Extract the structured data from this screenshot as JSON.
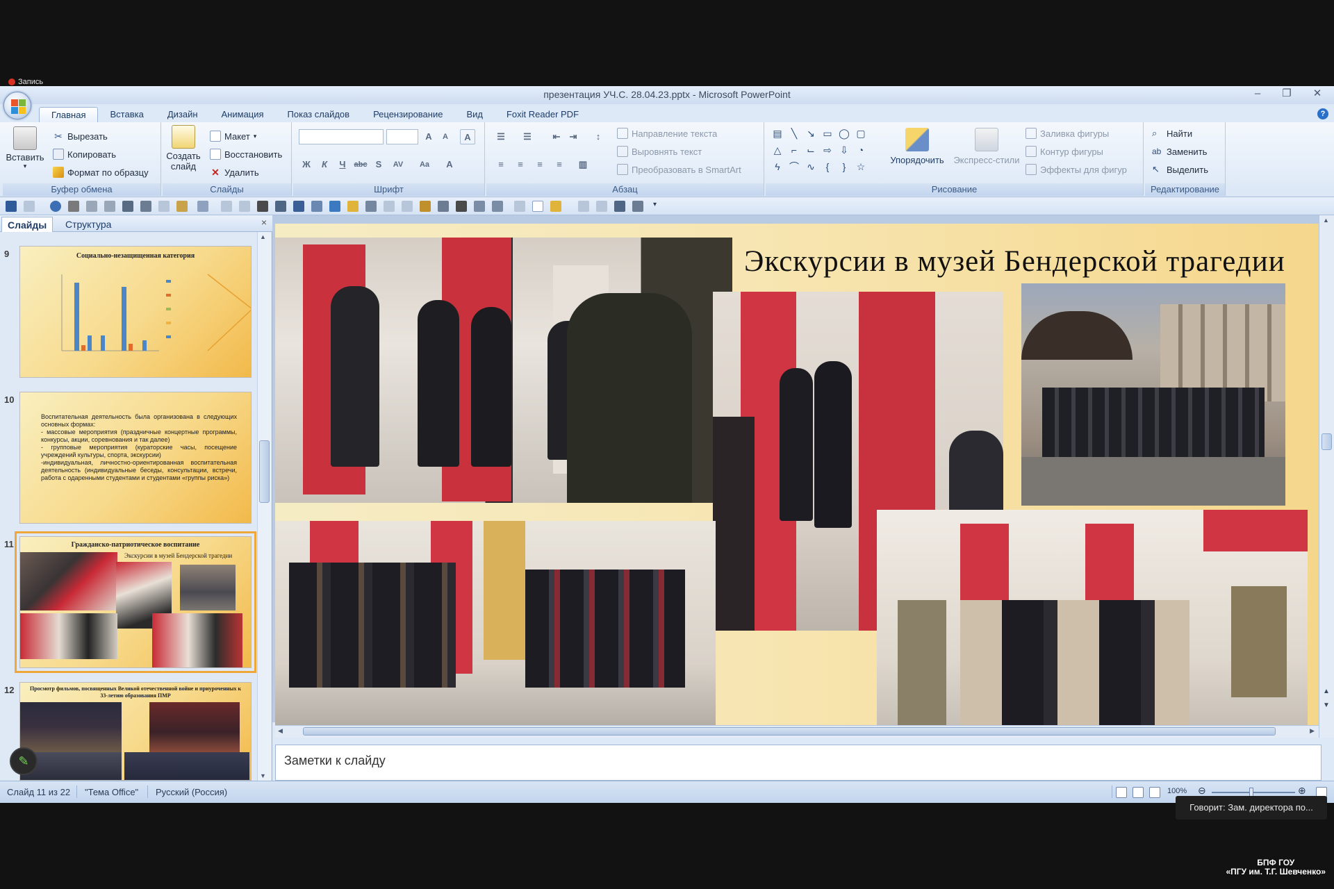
{
  "recording": {
    "label": "Запись"
  },
  "window": {
    "title": "презентация УЧ.С. 28.04.23.pptx - Microsoft PowerPoint",
    "controls": [
      "‒",
      "❐",
      "✕"
    ]
  },
  "ribbon_tabs": [
    "Главная",
    "Вставка",
    "Дизайн",
    "Анимация",
    "Показ слайдов",
    "Рецензирование",
    "Вид",
    "Foxit Reader PDF"
  ],
  "active_tab": "Главная",
  "clipboard": {
    "paste": "Вставить",
    "cut": "Вырезать",
    "copy": "Копировать",
    "format_painter": "Формат по образцу",
    "group": "Буфер обмена"
  },
  "slides_group": {
    "new_slide_1": "Создать",
    "new_slide_2": "слайд",
    "layout": "Макет",
    "reset": "Восстановить",
    "delete": "Удалить",
    "group": "Слайды"
  },
  "font_group": {
    "group": "Шрифт"
  },
  "paragraph_group": {
    "text_direction": "Направление текста",
    "align_text": "Выровнять текст",
    "smartart": "Преобразовать в SmartArt",
    "group": "Абзац"
  },
  "drawing_group": {
    "arrange": "Упорядочить",
    "quick_styles": "Экспресс-стили",
    "fill": "Заливка фигуры",
    "outline": "Контур фигуры",
    "effects": "Эффекты для фигур",
    "group": "Рисование"
  },
  "editing_group": {
    "find": "Найти",
    "replace": "Заменить",
    "select": "Выделить",
    "group": "Редактирование"
  },
  "panel": {
    "tab_slides": "Слайды",
    "tab_outline": "Структура",
    "close": "×"
  },
  "thumbnails": [
    {
      "num": "9",
      "title": "Социально-незащищенная категория"
    },
    {
      "num": "10",
      "body": "Воспитательная деятельность была организована в следующих основных формах:\n- массовые мероприятия (праздничные концертные программы, конкурсы, акции, соревнования и так далее)\n- групповые мероприятия (кураторские часы, посещение учреждений культуры, спорта, экскурсии)\n-индивидуальная, личностно-ориентированная воспитательная деятельность (индивидуальные беседы, консультации, встречи, работа с одаренными студентами и студентами «группы риска»)"
    },
    {
      "num": "11",
      "title": "Гражданско-патриотическое воспитание",
      "subtitle": "Экскурсии в музей Бендерской трагедии"
    },
    {
      "num": "12",
      "title": "Просмотр фильмов, посвященных Великой отечественной войне и приуроченных к 33-летию образования ПМР"
    }
  ],
  "slide": {
    "title": "Экскурсии в музей Бендерской трагедии"
  },
  "notes": {
    "placeholder": "Заметки к слайду"
  },
  "status": {
    "slide_pos": "Слайд 11 из 22",
    "theme": "\"Тема Office\"",
    "language": "Русский (Россия)",
    "zoom": "100%"
  },
  "speaking": {
    "text": "Говорит: Зам. директора по..."
  },
  "org": {
    "line1": "БПФ ГОУ",
    "line2": "«ПГУ им. Т.Г. Шевченко»"
  }
}
